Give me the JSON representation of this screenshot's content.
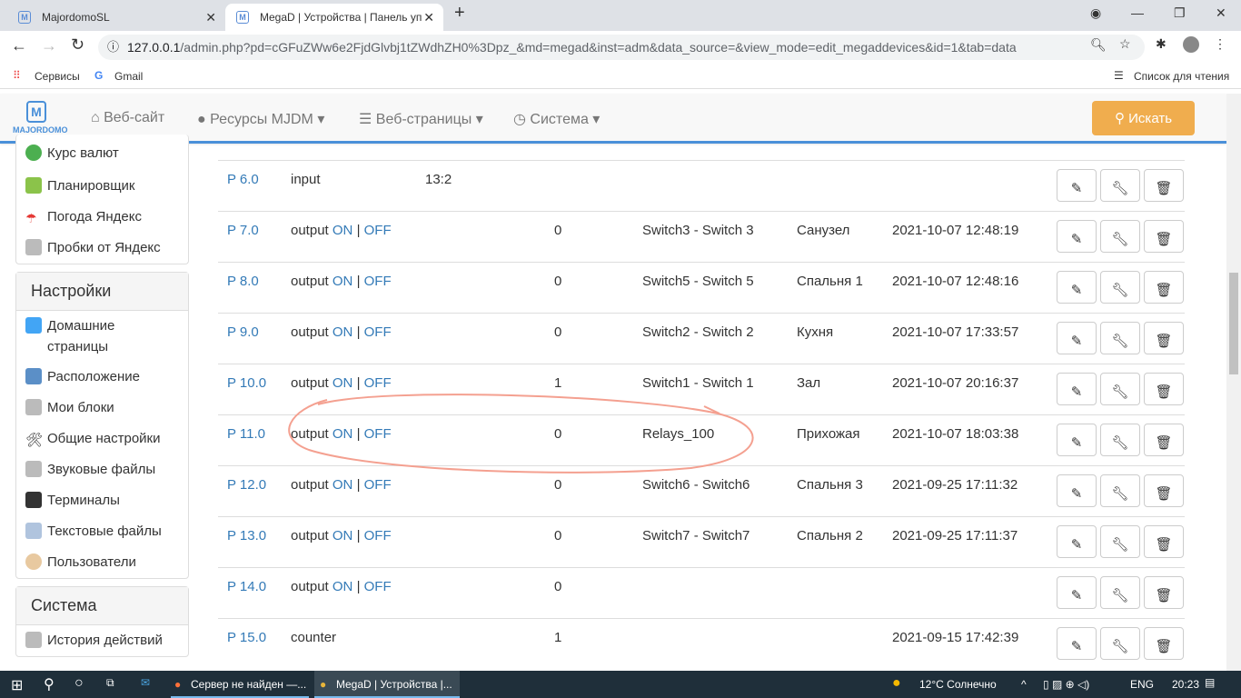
{
  "browser": {
    "tabs": [
      {
        "title": "MajordomoSL"
      },
      {
        "title": "MegaD | Устройства | Панель уп"
      }
    ],
    "url_host": "127.0.0.1",
    "url_rest": "/admin.php?pd=cGFuZWw6e2FjdGlvbj1tZWdhZH0%3Dpz_&md=megad&inst=adm&data_source=&view_mode=edit_megaddevices&id=1&tab=data",
    "bookmarks": [
      "Сервисы",
      "Gmail"
    ],
    "reading_list": "Список для чтения"
  },
  "navbar": {
    "logo": "MAJORDOMO",
    "items": [
      "Веб-сайт",
      "Ресурсы MJDM",
      "Веб-страницы",
      "Система"
    ],
    "search": "Искать",
    "accent": "#f0ad4e"
  },
  "sidebar": {
    "top_items": [
      "Курс валют",
      "Планировщик",
      "Погода Яндекс",
      "Пробки от Яндекс"
    ],
    "settings_title": "Настройки",
    "settings_items": [
      "Домашние страницы",
      "Расположение",
      "Мои блоки",
      "Общие настройки",
      "Звуковые файлы",
      "Терминалы",
      "Текстовые файлы",
      "Пользователи"
    ],
    "system_title": "Система",
    "system_items": [
      "История действий"
    ]
  },
  "table": {
    "on": "ON",
    "off": "OFF",
    "sep": "|",
    "rows": [
      {
        "port": "P 6.0",
        "type": "input",
        "toggle": false,
        "extra": "13:2",
        "value": "",
        "name": "",
        "room": "",
        "date": ""
      },
      {
        "port": "P 7.0",
        "type": "output",
        "toggle": true,
        "extra": "",
        "value": "0",
        "name": "Switch3 - Switch 3",
        "room": "Санузел",
        "date": "2021-10-07 12:48:19"
      },
      {
        "port": "P 8.0",
        "type": "output",
        "toggle": true,
        "extra": "",
        "value": "0",
        "name": "Switch5 - Switch 5",
        "room": "Спальня 1",
        "date": "2021-10-07 12:48:16"
      },
      {
        "port": "P 9.0",
        "type": "output",
        "toggle": true,
        "extra": "",
        "value": "0",
        "name": "Switch2 - Switch 2",
        "room": "Кухня",
        "date": "2021-10-07 17:33:57"
      },
      {
        "port": "P 10.0",
        "type": "output",
        "toggle": true,
        "extra": "",
        "value": "1",
        "name": "Switch1 - Switch 1",
        "room": "Зал",
        "date": "2021-10-07 20:16:37"
      },
      {
        "port": "P 11.0",
        "type": "output",
        "toggle": true,
        "extra": "",
        "value": "0",
        "name": "Relays_100",
        "room": "Прихожая",
        "date": "2021-10-07 18:03:38"
      },
      {
        "port": "P 12.0",
        "type": "output",
        "toggle": true,
        "extra": "",
        "value": "0",
        "name": "Switch6 - Switch6",
        "room": "Спальня 3",
        "date": "2021-09-25 17:11:32"
      },
      {
        "port": "P 13.0",
        "type": "output",
        "toggle": true,
        "extra": "",
        "value": "0",
        "name": "Switch7 - Switch7",
        "room": "Спальня 2",
        "date": "2021-09-25 17:11:37"
      },
      {
        "port": "P 14.0",
        "type": "output",
        "toggle": true,
        "extra": "",
        "value": "0",
        "name": "",
        "room": "",
        "date": ""
      },
      {
        "port": "P 15.0",
        "type": "counter",
        "toggle": false,
        "extra": "",
        "value": "1",
        "name": "",
        "room": "",
        "date": "2021-09-15 17:42:39"
      }
    ]
  },
  "taskbar": {
    "apps": [
      "Сервер не найден —...",
      "MegaD | Устройства |..."
    ],
    "weather": "12°C  Солнечно",
    "lang": "ENG",
    "time": "20:23"
  }
}
